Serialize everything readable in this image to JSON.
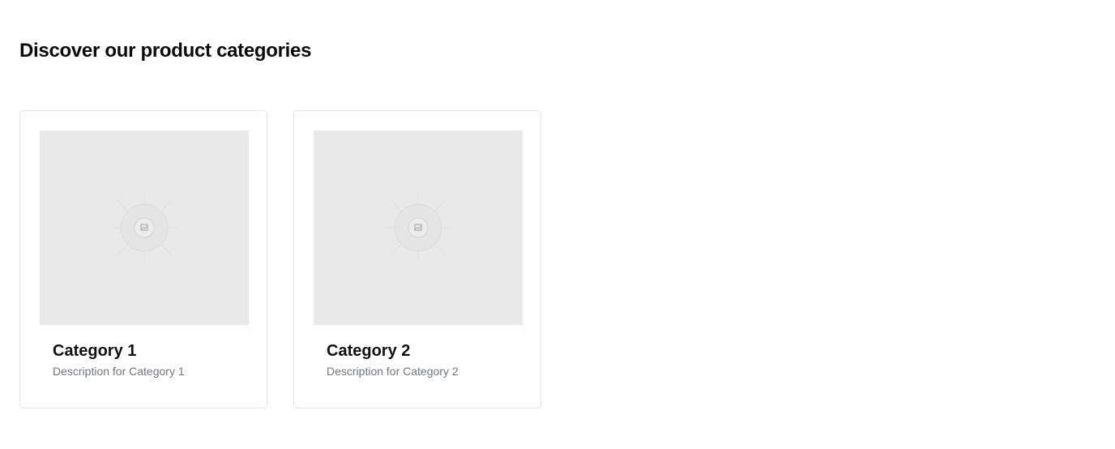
{
  "page": {
    "title": "Discover our product categories"
  },
  "categories": [
    {
      "title": "Category 1",
      "description": "Description for Category 1",
      "image_icon": "image-placeholder-icon"
    },
    {
      "title": "Category 2",
      "description": "Description for Category 2",
      "image_icon": "image-placeholder-icon"
    }
  ],
  "colors": {
    "placeholder_bg": "#e9e9e9",
    "card_border": "#e6e6e6",
    "title_text": "#111111",
    "description_text": "#707784"
  }
}
